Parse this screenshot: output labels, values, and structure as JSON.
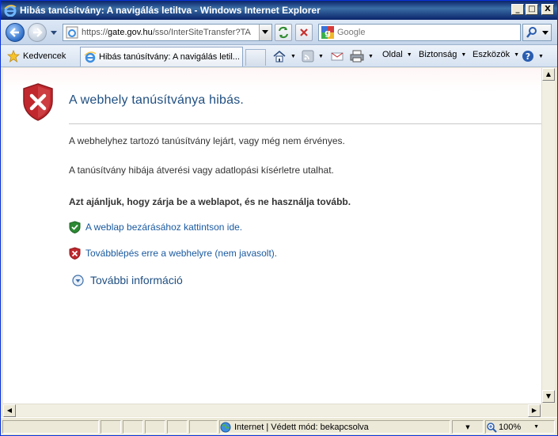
{
  "window": {
    "title": "Hibás tanúsítvány: A navigálás letiltva - Windows Internet Explorer",
    "minimize": "_",
    "maximize": "□",
    "close": "X"
  },
  "address": {
    "url_prefix": "https://",
    "url_host": "gate.gov.hu",
    "url_path": "/sso/InterSiteTransfer?TA",
    "search_placeholder": "Google"
  },
  "toolbar": {
    "favorites_label": "Kedvencek",
    "tab_title": "Hibás tanúsítvány: A navigálás letil...",
    "page_menu": "Oldal",
    "safety_menu": "Biztonság",
    "tools_menu": "Eszközök"
  },
  "content": {
    "title": "A webhely tanúsítványa hibás.",
    "paragraph1": "A webhelyhez tartozó tanúsítvány lejárt, vagy még nem érvényes.",
    "paragraph2": "A tanúsítvány hibája átverési vagy adatlopási kísérletre utalhat.",
    "recommendation": "Azt ajánljuk, hogy zárja be a weblapot, és ne használja tovább.",
    "close_link": "A weblap bezárásához kattintson ide.",
    "continue_link": "Továbblépés erre a webhelyre (nem javasolt).",
    "more_info": "További információ"
  },
  "status": {
    "zone": "Internet | Védett mód: bekapcsolva",
    "zoom": "100%"
  },
  "colors": {
    "title_bar": "#0a246a",
    "link": "#1a5aa0",
    "heading": "#1f4f82",
    "shield_red": "#c0282d",
    "shield_green": "#2d8a34"
  }
}
